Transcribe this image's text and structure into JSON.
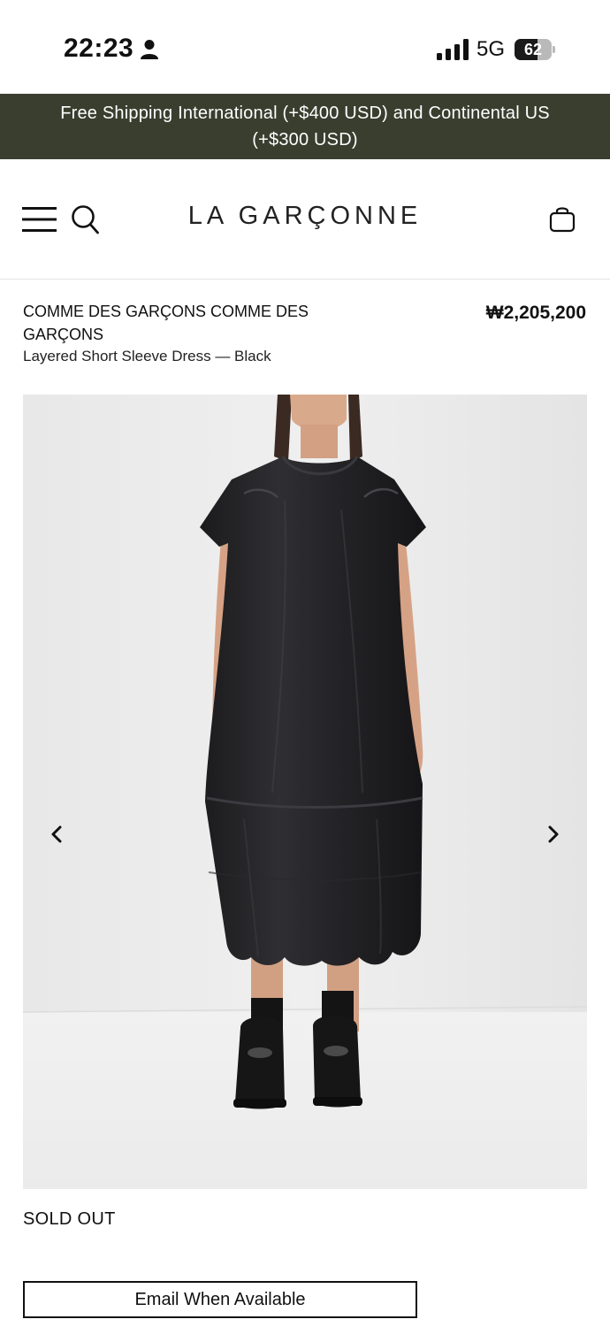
{
  "status_bar": {
    "time": "22:23",
    "network": "5G",
    "battery_percent": 62,
    "battery_label": "62",
    "icons": [
      "person-icon",
      "signal-icon",
      "battery-icon"
    ]
  },
  "banner": {
    "text": "Free Shipping International (+$400 USD) and Continental US (+$300 USD)",
    "background_color": "#3a3e2f"
  },
  "header": {
    "logo": "LA GARÇONNE",
    "icons": [
      "menu-icon",
      "search-icon",
      "shopping-bag-icon"
    ]
  },
  "product": {
    "brand": "COMME DES GARÇONS COMME DES GARÇONS",
    "name": "Layered Short Sleeve Dress — Black",
    "price": "₩2,205,200",
    "availability": "SOLD OUT",
    "cta_label": "Email When Available"
  },
  "carousel": {
    "prev_icon": "chevron-left-icon",
    "next_icon": "chevron-right-icon"
  }
}
